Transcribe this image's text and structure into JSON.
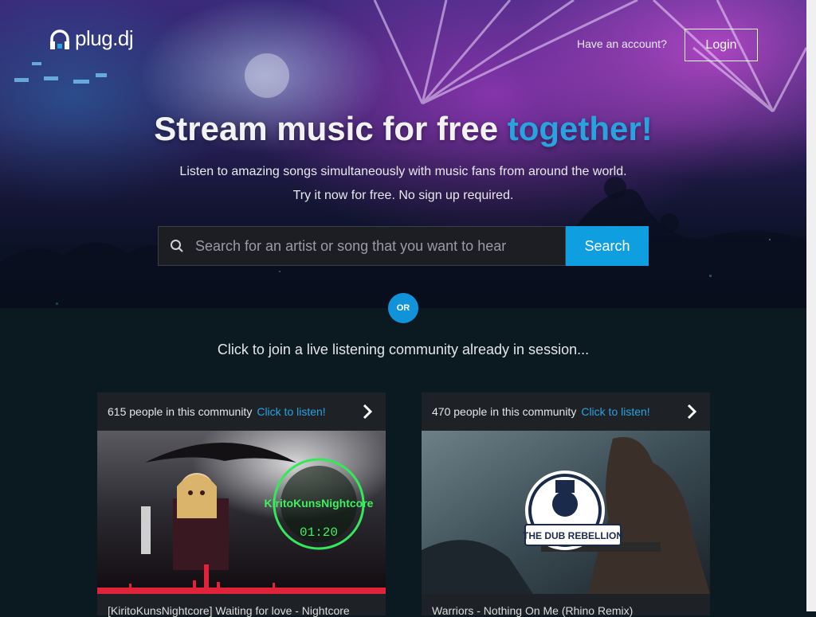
{
  "brand": {
    "name": "plug.dj"
  },
  "header": {
    "account_prompt": "Have an account?",
    "login_label": "Login"
  },
  "hero": {
    "headline_main": "Stream music for free",
    "headline_accent": "together!",
    "subline_1": "Listen to amazing songs simultaneously with music fans from around the world.",
    "subline_2": "Try it now for free. No sign up required."
  },
  "search": {
    "placeholder": "Search for an artist or song that you want to hear",
    "button_label": "Search",
    "icon": "search-icon"
  },
  "divider": {
    "label": "OR"
  },
  "communities": {
    "intro": "Click to join a live listening community already in session...",
    "cards": [
      {
        "count_text": "615 people in this community",
        "link_text": "Click to listen!",
        "art_text": "01:20",
        "title": "[KiritoKunsNightcore] Waiting for love - Nightcore"
      },
      {
        "count_text": "470 people in this community",
        "link_text": "Click to listen!",
        "art_text": "THE DUB REBELLION",
        "title": "Warriors - Nothing On Me (Rhino Remix)"
      }
    ]
  },
  "colors": {
    "accent": "#29a3e0",
    "button": "#0f9ee0",
    "background": "#0b1a20",
    "card": "#1e2126"
  }
}
